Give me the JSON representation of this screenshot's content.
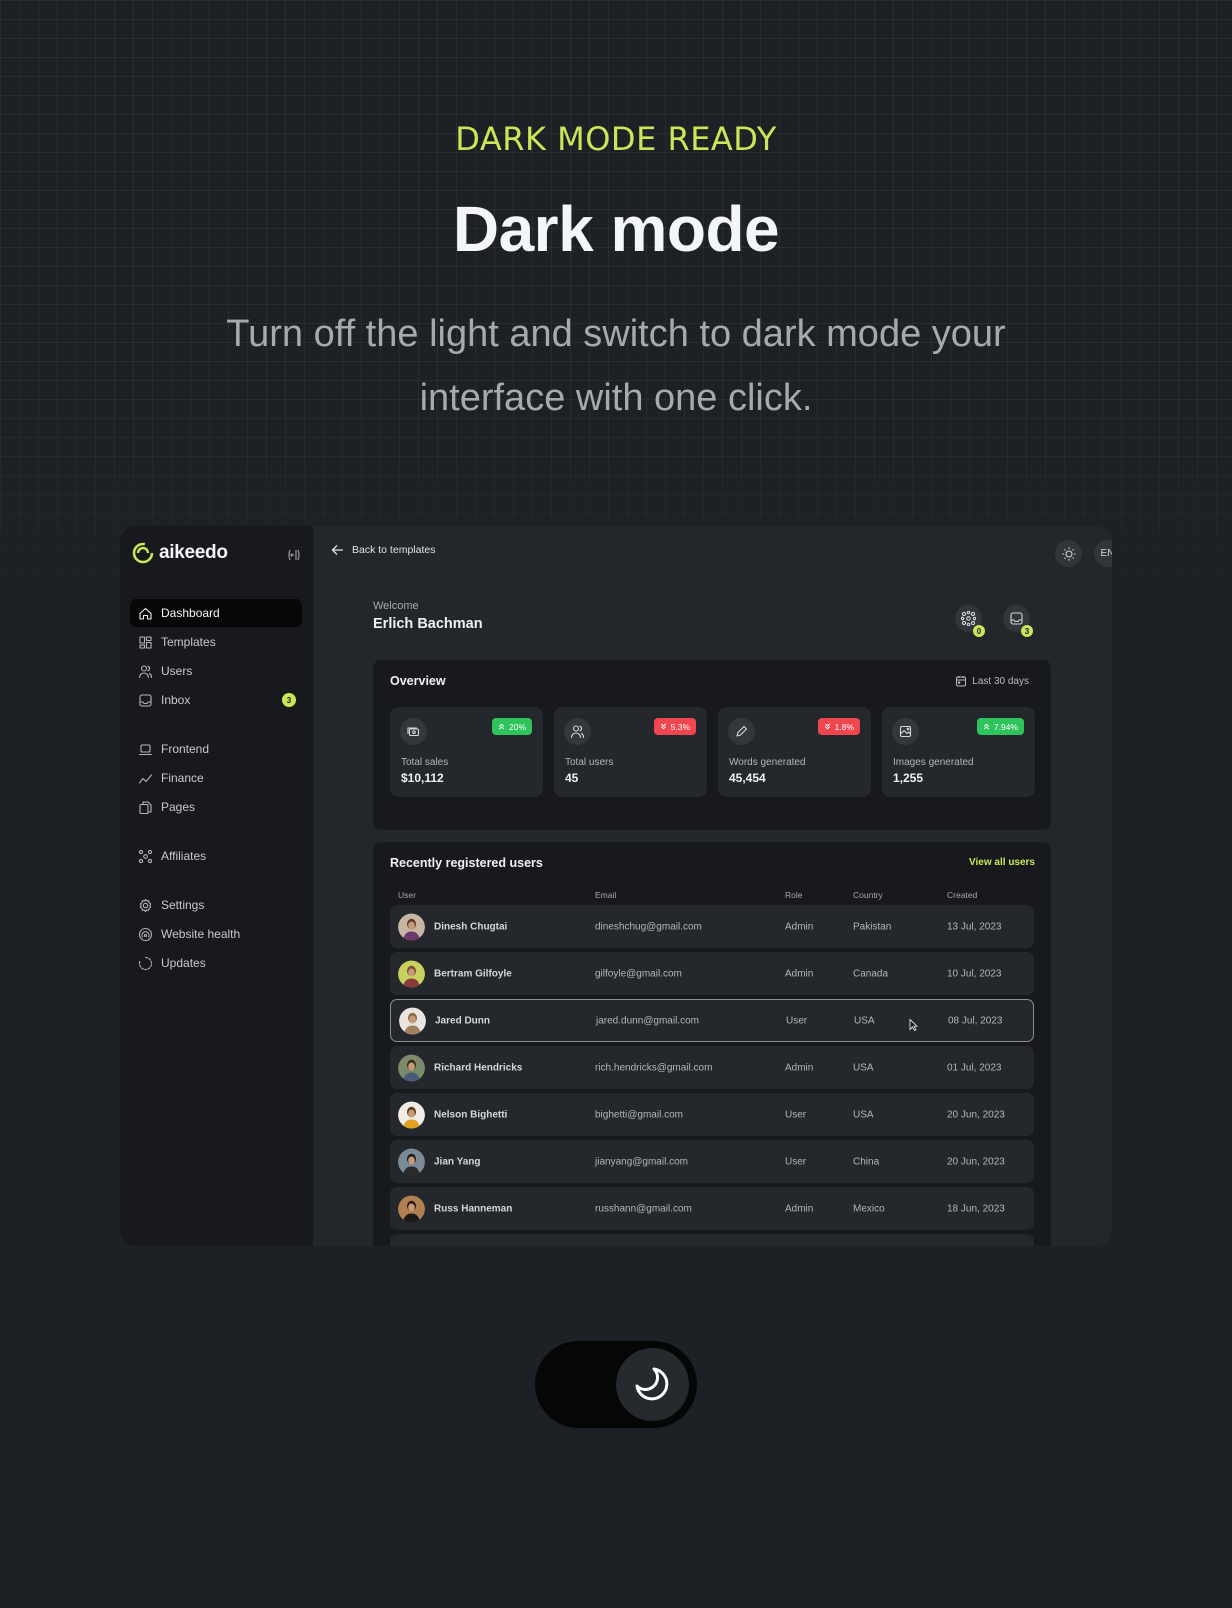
{
  "hero": {
    "eyebrow": "DARK MODE READY",
    "title": "Dark mode",
    "subtitle": "Turn off the light and switch to dark mode your interface with one click."
  },
  "colors": {
    "accent": "#c8e85a",
    "positive": "#2fc35b",
    "negative": "#f04650",
    "background": "#1d2024",
    "sidebar": "#17191c",
    "panel": "#17191c",
    "card": "#24272c"
  },
  "app": {
    "brand": "aikeedo",
    "sidebar": {
      "groups": [
        [
          {
            "label": "Dashboard",
            "icon": "home-icon",
            "active": true
          },
          {
            "label": "Templates",
            "icon": "grid-icon"
          },
          {
            "label": "Users",
            "icon": "users-icon"
          },
          {
            "label": "Inbox",
            "icon": "inbox-icon",
            "badge": "3"
          }
        ],
        [
          {
            "label": "Frontend",
            "icon": "laptop-icon"
          },
          {
            "label": "Finance",
            "icon": "trend-icon"
          },
          {
            "label": "Pages",
            "icon": "pages-icon"
          }
        ],
        [
          {
            "label": "Affiliates",
            "icon": "affiliates-icon"
          }
        ],
        [
          {
            "label": "Settings",
            "icon": "gear-icon"
          },
          {
            "label": "Website health",
            "icon": "signal-icon"
          },
          {
            "label": "Updates",
            "icon": "loader-icon"
          }
        ]
      ]
    },
    "topbar": {
      "back_label": "Back to templates",
      "language": "EN",
      "user_name": "Erlich Bachman"
    },
    "welcome": {
      "label": "Welcome",
      "name": "Erlich Bachman",
      "affiliates_count": "0",
      "inbox_count": "3"
    },
    "overview": {
      "title": "Overview",
      "range": "Last 30 days",
      "stats": [
        {
          "label": "Total sales",
          "value": "$10,112",
          "change": "20%",
          "direction": "up",
          "icon": "money-icon"
        },
        {
          "label": "Total users",
          "value": "45",
          "change": "5.3%",
          "direction": "down",
          "icon": "users-icon"
        },
        {
          "label": "Words generated",
          "value": "45,454",
          "change": "1.8%",
          "direction": "down",
          "icon": "pencil-icon"
        },
        {
          "label": "Images generated",
          "value": "1,255",
          "change": "7.94%",
          "direction": "up",
          "icon": "image-icon"
        }
      ]
    },
    "recent_users": {
      "title": "Recently registered users",
      "view_all": "View all users",
      "columns": [
        "User",
        "Email",
        "Role",
        "Country",
        "Created"
      ],
      "rows": [
        {
          "name": "Dinesh Chugtai",
          "email": "dineshchug@gmail.com",
          "role": "Admin",
          "country": "Pakistan",
          "created": "13 Jul, 2023"
        },
        {
          "name": "Bertram Gilfoyle",
          "email": "gilfoyle@gmail.com",
          "role": "Admin",
          "country": "Canada",
          "created": "10 Jul, 2023"
        },
        {
          "name": "Jared Dunn",
          "email": "jared.dunn@gmail.com",
          "role": "User",
          "country": "USA",
          "created": "08 Jul, 2023",
          "hover": true
        },
        {
          "name": "Richard Hendricks",
          "email": "rich.hendricks@gmail.com",
          "role": "Admin",
          "country": "USA",
          "created": "01 Jul, 2023"
        },
        {
          "name": "Nelson Bighetti",
          "email": "bighetti@gmail.com",
          "role": "User",
          "country": "USA",
          "created": "20 Jun, 2023"
        },
        {
          "name": "Jian Yang",
          "email": "jianyang@gmail.com",
          "role": "User",
          "country": "China",
          "created": "20 Jun, 2023"
        },
        {
          "name": "Russ Hanneman",
          "email": "russhann@gmail.com",
          "role": "Admin",
          "country": "Mexico",
          "created": "18 Jun, 2023"
        }
      ]
    }
  },
  "theme_toggle": {
    "state": "dark",
    "icon": "moon-icon"
  }
}
